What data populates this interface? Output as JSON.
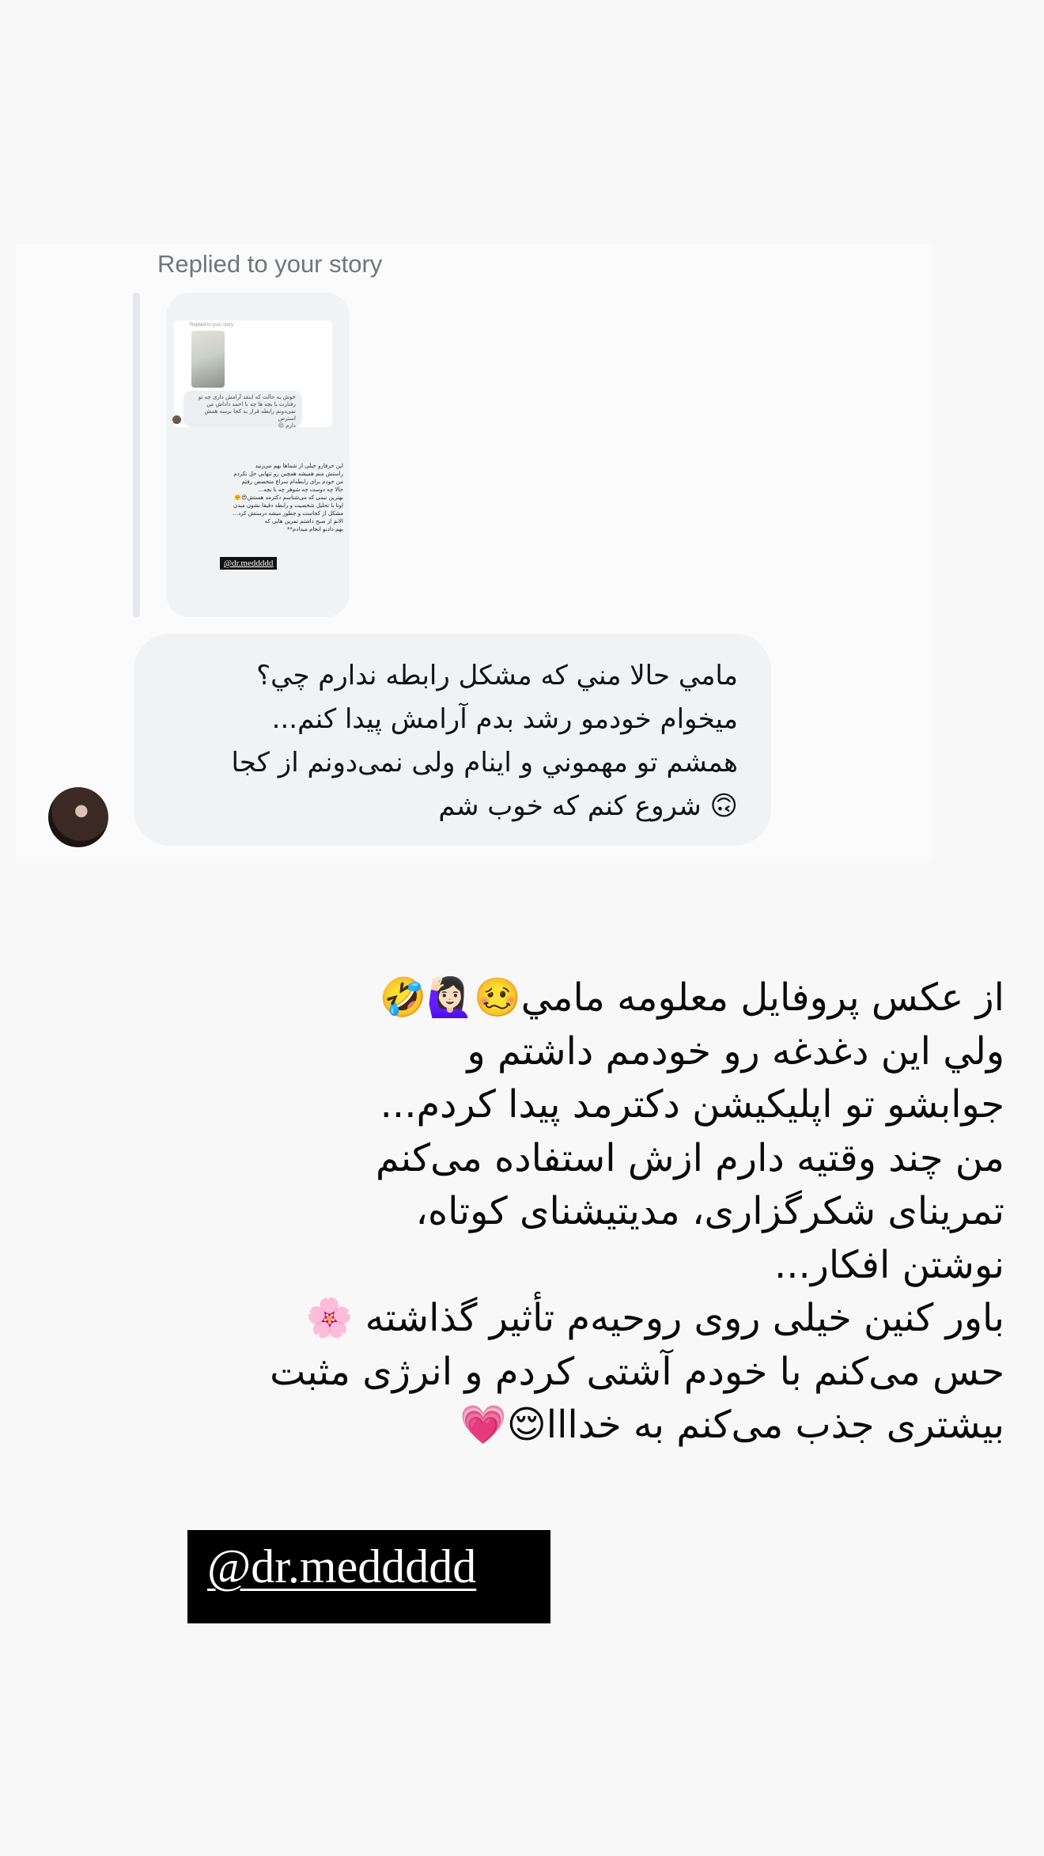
{
  "reply": {
    "label": "Replied to your story"
  },
  "story_preview": {
    "inner_label": "Replied to your story",
    "inner_message": "خوش به حالت که اینقد آرامش داری چه تو\nرفتارت با بچه ها چه با احمد داداش من\nنمی‌دونم رابطه قرار به کجا برسه همش استرس\nدارم 😔",
    "body_text": "این حرفارو خیلی از شماها بهم می‌زنید\nراستش منم همیشه همچین رو تنهایی حل نکردم\nمن خودم برای رابطه‌ام سراغ متخصص رفتم\nحالا چه دوست چه شوهر چه با بچه...\nبهترین تیمی که می‌شناسم دکترمد هستش😍🤗\nاونا با تحلیل شخصیت و رابطه دقیقا نشون میدن\nمشکل از کجاست و چطور میشه درستش کرد...\nالانم از صبح داشتم تمرین هایی که\nبهم دادنو انجام میدادم**",
    "tag": "@dr.meddddd"
  },
  "message": {
    "lines": [
      "مامي حالا مني كه مشكل رابطه ندارم چي؟",
      "ميخوام خودمو رشد بدم آرامش پيدا كنم...",
      "همشم تو مهموني و اينام ولی نمی‌دونم از كجا",
      "🙃 شروع كنم كه خوب شم"
    ]
  },
  "caption": {
    "lines": [
      "از عکس پروفایل معلومه مامي🥴🙋🏻‍♀️🤣",
      "ولي این دغدغه رو خودمم داشتم و",
      "جوابشو تو اپلیکیشن دکترمد پیدا کردم...",
      "من چند وقتیه دارم ازش استفاده می‌کنم",
      "تمرینای شکرگزاری، مدیتیشنای کوتاه،",
      "نوشتن افکار...",
      "باور کنین خیلی روی روحیه‌م تأثیر گذاشته 🌸",
      "حس می‌کنم با خودم آشتی کردم و انرژی مثبت",
      "بیشتری جذب می‌کنم به خدااا😌💗"
    ]
  },
  "mention": {
    "text": "@dr.meddddd"
  },
  "icons": {
    "sender_avatar": "profile-photo"
  }
}
